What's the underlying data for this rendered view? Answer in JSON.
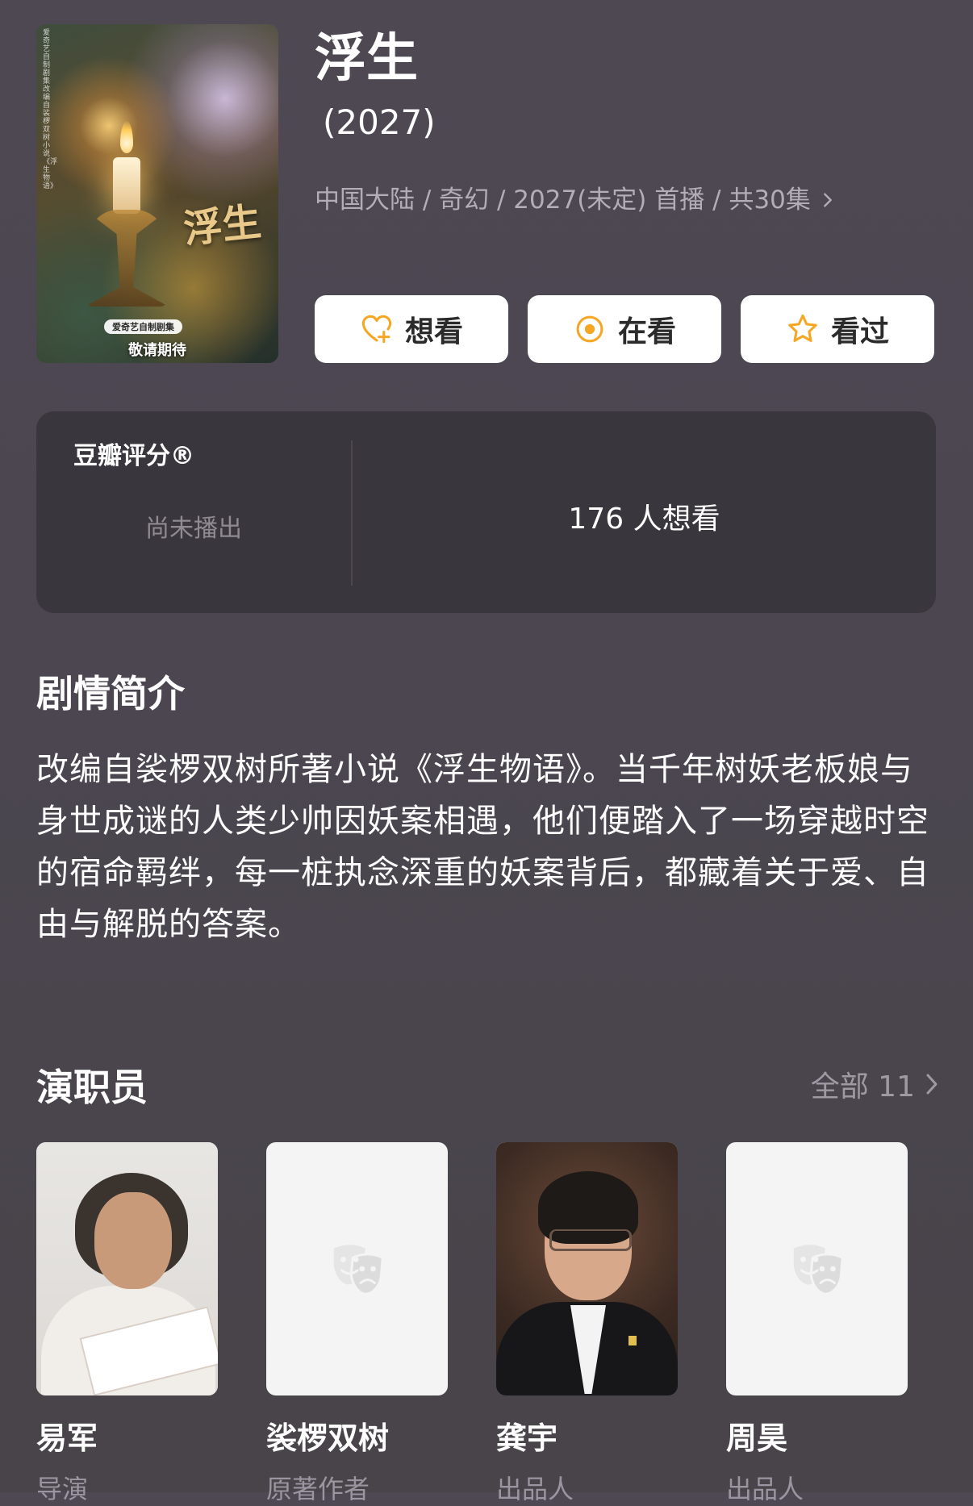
{
  "poster": {
    "calligraphy": "浮生",
    "vertical_text": "爱奇艺自制剧集 改编自裟椤双树小说《浮生物语》",
    "badge": "爱奇艺自制剧集",
    "tagline": "敬请期待"
  },
  "header": {
    "title": "浮生",
    "year": "(2027)",
    "meta": "中国大陆 / 奇幻 / 2027(未定) 首播 / 共30集"
  },
  "actions": [
    {
      "label": "想看",
      "icon": "heart-plus-icon",
      "color": "#f5a623"
    },
    {
      "label": "在看",
      "icon": "target-icon",
      "color": "#f5a623"
    },
    {
      "label": "看过",
      "icon": "star-outline-icon",
      "color": "#f5a623"
    }
  ],
  "rating": {
    "label": "豆瓣评分®",
    "status": "尚未播出",
    "wish_count": "176 人想看"
  },
  "synopsis": {
    "title": "剧情简介",
    "text": "改编自裟椤双树所著小说《浮生物语》。当千年树妖老板娘与身世成谜的人类少帅因妖案相遇，他们便踏入了一场穿越时空的宿命羁绊，每一桩执念深重的妖案背后，都藏着关于爱、自由与解脱的答案。"
  },
  "cast": {
    "title": "演职员",
    "all_label": "全部 11",
    "members": [
      {
        "name": "易军",
        "role": "导演"
      },
      {
        "name": "裟椤双树",
        "role": "原著作者"
      },
      {
        "name": "龚宇",
        "role": "出品人"
      },
      {
        "name": "周昊",
        "role": "出品人"
      }
    ]
  },
  "colors": {
    "background": "#4b4650",
    "card": "#3a363d",
    "accent": "#f5a623",
    "muted_text": "#9a95a0"
  }
}
